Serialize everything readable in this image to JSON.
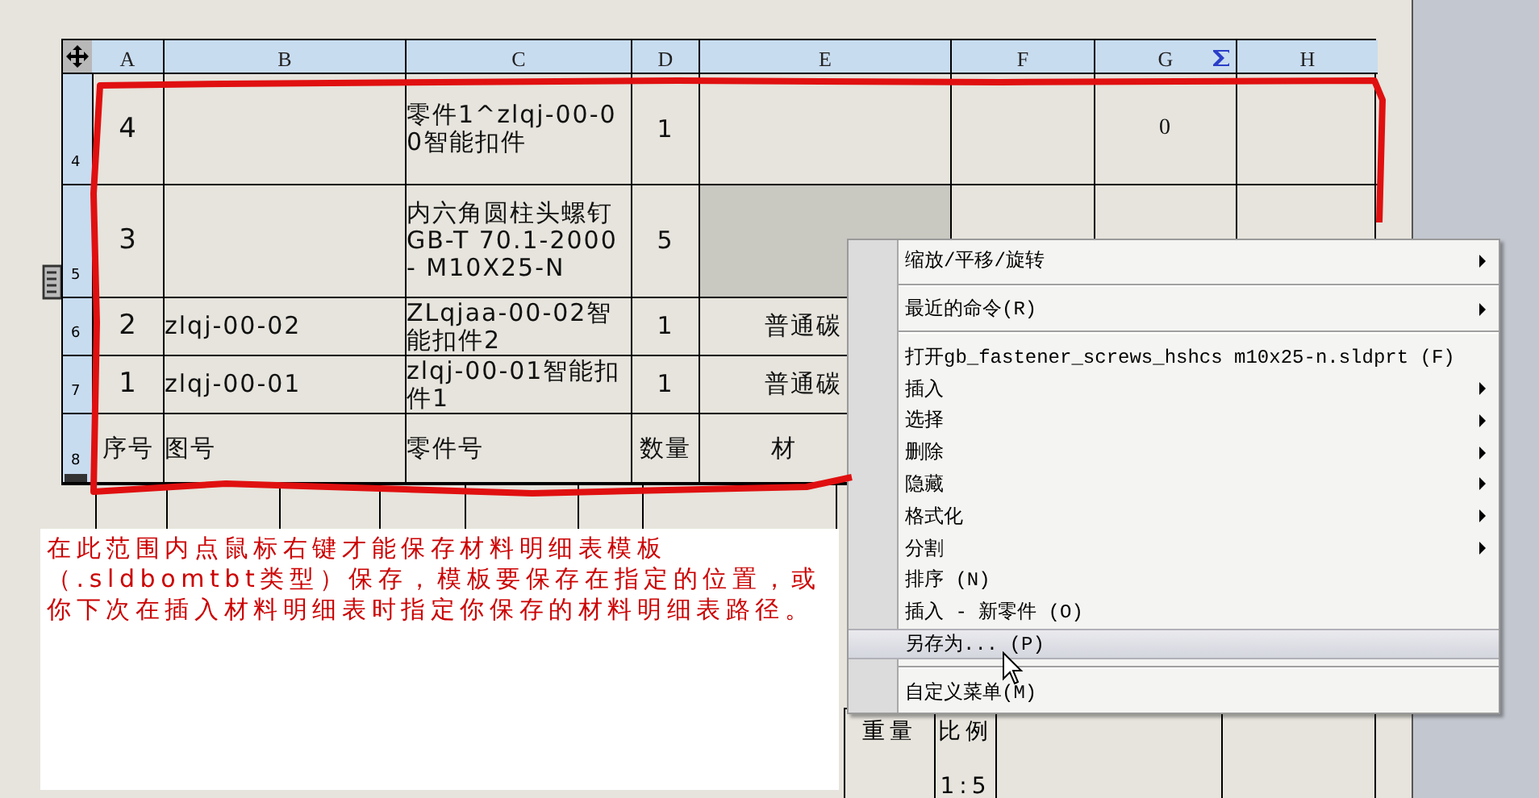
{
  "table": {
    "columns": [
      {
        "label": "A",
        "sum": false
      },
      {
        "label": "B",
        "sum": false
      },
      {
        "label": "C",
        "sum": false
      },
      {
        "label": "D",
        "sum": false
      },
      {
        "label": "E",
        "sum": false
      },
      {
        "label": "F",
        "sum": false
      },
      {
        "label": "G",
        "sum": true
      },
      {
        "label": "H",
        "sum": false
      }
    ],
    "rows": [
      {
        "label": "4",
        "cells": [
          {
            "text": "4",
            "selected": false
          },
          {
            "selected": false
          },
          {
            "text": "零件1^zlqj-00-00智能扣件",
            "selected": false
          },
          {
            "text": "1",
            "selected": false
          },
          {
            "selected": false
          },
          {
            "selected": false
          },
          {
            "text": "0",
            "selected": false
          },
          {
            "selected": false
          }
        ]
      },
      {
        "label": "5",
        "cells": [
          {
            "text": "3",
            "selected": false
          },
          {
            "selected": false
          },
          {
            "text": "内六角圆柱头螺钉 GB-T 70.1-2000 - M10X25-N",
            "selected": false
          },
          {
            "text": "5",
            "selected": false
          },
          {
            "selected": true
          },
          {
            "selected": false
          },
          {
            "selected": false
          },
          {
            "selected": false
          }
        ]
      },
      {
        "label": "6",
        "cells": [
          {
            "text": "2",
            "selected": false
          },
          {
            "text": "zlqj-00-02",
            "selected": false
          },
          {
            "text": "ZLqjaa-00-02智能扣件2",
            "selected": false
          },
          {
            "text": "1",
            "selected": false
          },
          {
            "text": "普通碳",
            "selected": false
          }
        ]
      },
      {
        "label": "7",
        "cells": [
          {
            "text": "1",
            "selected": false
          },
          {
            "text": "zlqj-00-01",
            "selected": false
          },
          {
            "text": "zlqj-00-01智能扣件1",
            "selected": false
          },
          {
            "text": "1",
            "selected": false
          },
          {
            "text": "普通碳",
            "selected": false
          }
        ]
      },
      {
        "label": "8",
        "cells": [
          {
            "text": "序号",
            "selected": false
          },
          {
            "text": "图号",
            "selected": false
          },
          {
            "text": "零件号",
            "selected": false
          },
          {
            "text": "数量",
            "selected": false
          },
          {
            "text": "材",
            "selected": false
          }
        ]
      }
    ]
  },
  "title_block": {
    "cells": [
      "重量",
      "比例",
      "1:5"
    ]
  },
  "note": {
    "text": "在此范围内点鼠标右键才能保存材料明细表模板（.sldbomtbt类型）保存，模板要保存在指定的位置，或你下次在插入材料明细表时指定你保存的材料明细表路径。"
  },
  "context_menu": {
    "items": [
      {
        "kind": "item",
        "label": "缩放/平移/旋转",
        "submenu": true,
        "selected": false
      },
      {
        "kind": "separator"
      },
      {
        "kind": "item",
        "label": "最近的命令(R)",
        "submenu": true,
        "selected": false
      },
      {
        "kind": "separator"
      },
      {
        "kind": "item",
        "label": "打开gb_fastener_screws_hshcs m10x25-n.sldprt (F)",
        "submenu": false,
        "selected": false
      },
      {
        "kind": "item",
        "label": "插入",
        "submenu": true,
        "selected": false
      },
      {
        "kind": "item",
        "label": "选择",
        "submenu": true,
        "selected": false
      },
      {
        "kind": "item",
        "label": "删除",
        "submenu": true,
        "selected": false
      },
      {
        "kind": "item",
        "label": "隐藏",
        "submenu": true,
        "selected": false
      },
      {
        "kind": "item",
        "label": "格式化",
        "submenu": true,
        "selected": false
      },
      {
        "kind": "item",
        "label": "分割",
        "submenu": true,
        "selected": false
      },
      {
        "kind": "item",
        "label": "排序 (N)",
        "submenu": false,
        "selected": false
      },
      {
        "kind": "item",
        "label": "插入 - 新零件 (O)",
        "submenu": false,
        "selected": false
      },
      {
        "kind": "item",
        "label": "另存为... (P)",
        "submenu": false,
        "selected": true
      },
      {
        "kind": "separator"
      },
      {
        "kind": "item",
        "label": "自定义菜单(M)",
        "submenu": false,
        "selected": false
      }
    ]
  }
}
